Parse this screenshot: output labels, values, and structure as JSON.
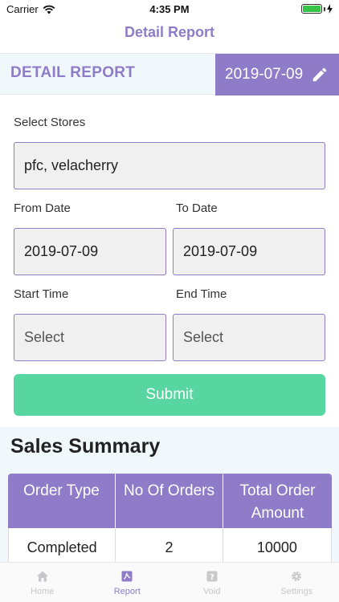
{
  "status_bar": {
    "carrier": "Carrier",
    "time": "4:35 PM"
  },
  "nav": {
    "title": "Detail Report"
  },
  "header": {
    "label": "DETAIL REPORT",
    "date": "2019-07-09"
  },
  "form": {
    "stores_label": "Select Stores",
    "stores_value": "pfc, velacherry",
    "from_label": "From Date",
    "from_value": "2019-07-09",
    "to_label": "To Date",
    "to_value": "2019-07-09",
    "start_label": "Start Time",
    "start_placeholder": "Select",
    "end_label": "End Time",
    "end_placeholder": "Select",
    "submit_label": "Submit"
  },
  "summary": {
    "title": "Sales Summary",
    "columns": [
      "Order Type",
      "No Of Orders",
      "Total Order Amount"
    ],
    "rows": [
      [
        "Completed",
        "2",
        "10000"
      ]
    ]
  },
  "tabs": [
    {
      "label": "Home",
      "icon": "home-icon",
      "active": false
    },
    {
      "label": "Report",
      "icon": "report-icon",
      "active": true
    },
    {
      "label": "Void",
      "icon": "void-icon",
      "active": false
    },
    {
      "label": "Settings",
      "icon": "gear-icon",
      "active": false
    }
  ],
  "colors": {
    "accent": "#8e7cc9",
    "submit": "#57d6a1",
    "band": "#f1f8fb"
  }
}
